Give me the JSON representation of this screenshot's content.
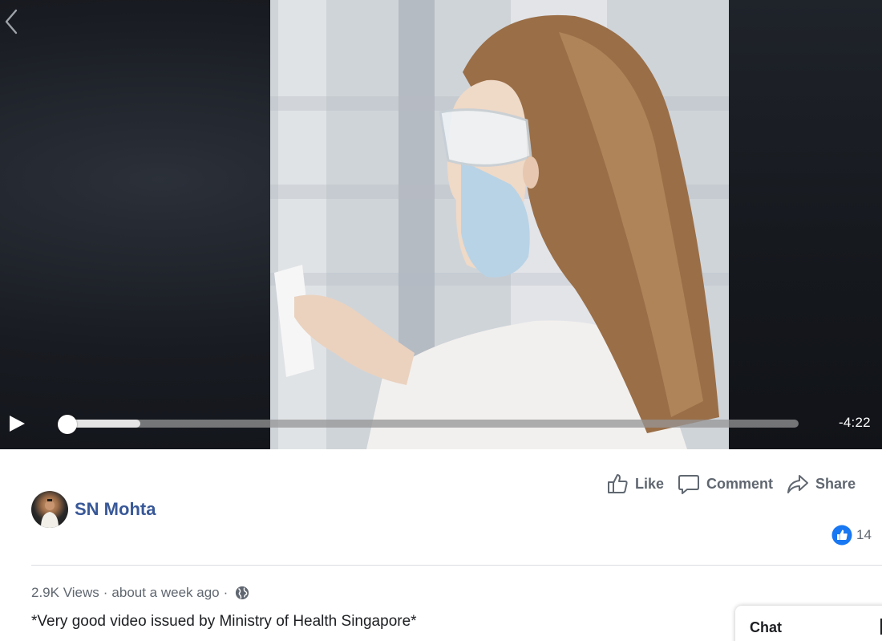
{
  "player": {
    "time_remaining": "-4:22",
    "progress": 0.0,
    "buffered": 0.1,
    "state": "paused"
  },
  "actions": {
    "like_label": "Like",
    "comment_label": "Comment",
    "share_label": "Share"
  },
  "post": {
    "author": "SN Mohta",
    "reaction_count": "14",
    "views": "2.9K Views",
    "separator": "·",
    "time_ago": "about a week ago",
    "privacy_icon": "globe-icon",
    "description": "*Very good video issued by Ministry of Health Singapore*"
  },
  "chat": {
    "label": "Chat"
  },
  "colors": {
    "author": "#385898",
    "muted_text": "#606770",
    "like_blue": "#1877f2"
  }
}
